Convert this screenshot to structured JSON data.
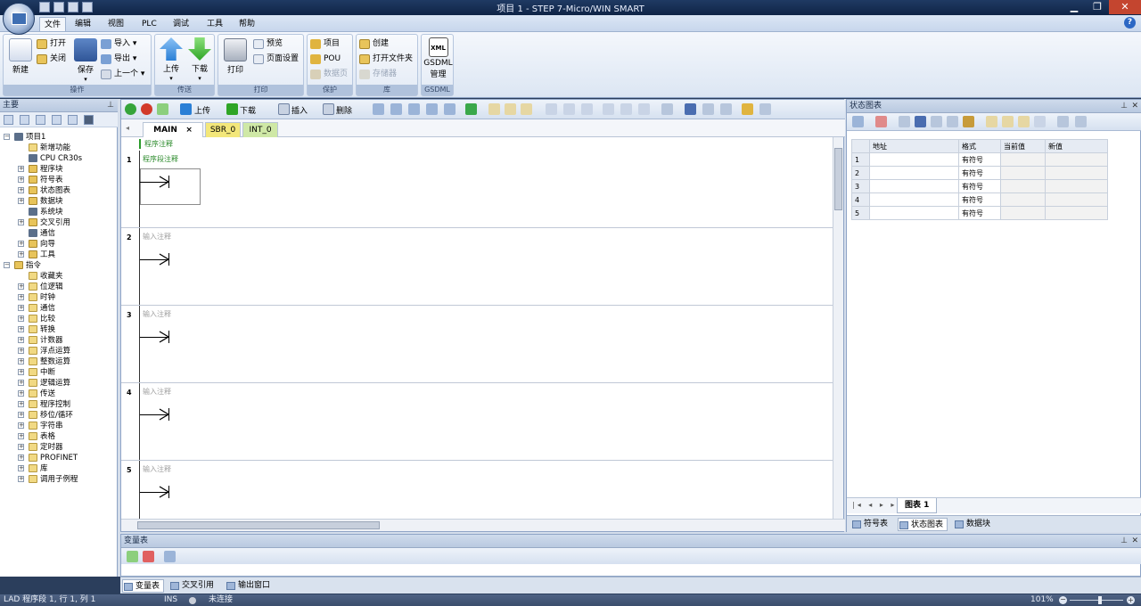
{
  "window": {
    "title": "项目 1 - STEP 7-Micro/WIN SMART"
  },
  "menu": [
    "文件",
    "编辑",
    "视图",
    "PLC",
    "调试",
    "工具",
    "帮助"
  ],
  "ribbon": {
    "groups": [
      {
        "label": "操作",
        "new": "新建",
        "open": "打开",
        "close": "关闭",
        "save": "保存",
        "import": "导入",
        "export": "导出",
        "previous": "上一个"
      },
      {
        "label": "传送",
        "upload": "上传",
        "download": "下载"
      },
      {
        "label": "打印",
        "print": "打印",
        "preview": "预览",
        "page_setup": "页面设置"
      },
      {
        "label": "保护",
        "project": "项目",
        "pou": "POU",
        "data_page": "数据页"
      },
      {
        "label": "库",
        "create": "创建",
        "open_folder": "打开文件夹",
        "memory": "存储器"
      },
      {
        "label": "GSDML",
        "gsdml_line1": "GSDML",
        "gsdml_line2": "管理",
        "xml": "XML"
      }
    ]
  },
  "tree": {
    "title": "主要",
    "items": [
      {
        "label": "项目1",
        "level": 0,
        "exp": "−",
        "icon": "project"
      },
      {
        "label": "新增功能",
        "level": 1,
        "exp": "",
        "icon": "new"
      },
      {
        "label": "CPU CR30s",
        "level": 1,
        "exp": "",
        "icon": "cpu"
      },
      {
        "label": "程序块",
        "level": 1,
        "exp": "+",
        "icon": "folder"
      },
      {
        "label": "符号表",
        "level": 1,
        "exp": "+",
        "icon": "folder"
      },
      {
        "label": "状态图表",
        "level": 1,
        "exp": "+",
        "icon": "folder"
      },
      {
        "label": "数据块",
        "level": 1,
        "exp": "+",
        "icon": "folder"
      },
      {
        "label": "系统块",
        "level": 1,
        "exp": "",
        "icon": "system"
      },
      {
        "label": "交叉引用",
        "level": 1,
        "exp": "+",
        "icon": "folder"
      },
      {
        "label": "通信",
        "level": 1,
        "exp": "",
        "icon": "comm"
      },
      {
        "label": "向导",
        "level": 1,
        "exp": "+",
        "icon": "folder"
      },
      {
        "label": "工具",
        "level": 1,
        "exp": "+",
        "icon": "folder"
      },
      {
        "label": "指令",
        "level": 0,
        "exp": "−",
        "icon": "folder"
      },
      {
        "label": "收藏夹",
        "level": 1,
        "exp": "",
        "icon": "folder2"
      },
      {
        "label": "位逻辑",
        "level": 1,
        "exp": "+",
        "icon": "folder2"
      },
      {
        "label": "时钟",
        "level": 1,
        "exp": "+",
        "icon": "folder2"
      },
      {
        "label": "通信",
        "level": 1,
        "exp": "+",
        "icon": "folder2"
      },
      {
        "label": "比较",
        "level": 1,
        "exp": "+",
        "icon": "folder2"
      },
      {
        "label": "转换",
        "level": 1,
        "exp": "+",
        "icon": "folder2"
      },
      {
        "label": "计数器",
        "level": 1,
        "exp": "+",
        "icon": "folder2"
      },
      {
        "label": "浮点运算",
        "level": 1,
        "exp": "+",
        "icon": "folder2"
      },
      {
        "label": "整数运算",
        "level": 1,
        "exp": "+",
        "icon": "folder2"
      },
      {
        "label": "中断",
        "level": 1,
        "exp": "+",
        "icon": "folder2"
      },
      {
        "label": "逻辑运算",
        "level": 1,
        "exp": "+",
        "icon": "folder2"
      },
      {
        "label": "传送",
        "level": 1,
        "exp": "+",
        "icon": "folder2"
      },
      {
        "label": "程序控制",
        "level": 1,
        "exp": "+",
        "icon": "folder2"
      },
      {
        "label": "移位/循环",
        "level": 1,
        "exp": "+",
        "icon": "folder2"
      },
      {
        "label": "字符串",
        "level": 1,
        "exp": "+",
        "icon": "folder2"
      },
      {
        "label": "表格",
        "level": 1,
        "exp": "+",
        "icon": "folder2"
      },
      {
        "label": "定时器",
        "level": 1,
        "exp": "+",
        "icon": "folder2"
      },
      {
        "label": "PROFINET",
        "level": 1,
        "exp": "+",
        "icon": "folder2"
      },
      {
        "label": "库",
        "level": 1,
        "exp": "+",
        "icon": "folder2"
      },
      {
        "label": "调用子例程",
        "level": 1,
        "exp": "+",
        "icon": "folder2"
      }
    ]
  },
  "editor": {
    "toolbar": {
      "upload": "上传",
      "download": "下载",
      "insert": "插入",
      "delete": "删除"
    },
    "tabs": [
      "MAIN",
      "SBR_0",
      "INT_0"
    ],
    "tab_close": "×",
    "program_comment": "程序注释",
    "networks": [
      {
        "num": "1",
        "comment": "程序段注释"
      },
      {
        "num": "2",
        "comment": "输入注释"
      },
      {
        "num": "3",
        "comment": "输入注释"
      },
      {
        "num": "4",
        "comment": "输入注释"
      },
      {
        "num": "5",
        "comment": "输入注释"
      }
    ]
  },
  "status_chart": {
    "title": "状态图表",
    "columns": [
      "地址",
      "格式",
      "当前值",
      "新值"
    ],
    "rows": [
      {
        "n": "1",
        "address": "",
        "format": "有符号",
        "current": "",
        "new": ""
      },
      {
        "n": "2",
        "address": "",
        "format": "有符号",
        "current": "",
        "new": ""
      },
      {
        "n": "3",
        "address": "",
        "format": "有符号",
        "current": "",
        "new": ""
      },
      {
        "n": "4",
        "address": "",
        "format": "有符号",
        "current": "",
        "new": ""
      },
      {
        "n": "5",
        "address": "",
        "format": "有符号",
        "current": "",
        "new": ""
      }
    ],
    "sheet_tab": "图表 1",
    "panel_tabs": [
      "符号表",
      "状态图表",
      "数据块"
    ]
  },
  "var_table": {
    "title": "变量表"
  },
  "bottom_tabs": [
    "变量表",
    "交叉引用",
    "输出窗口"
  ],
  "statusbar": {
    "position": "LAD 程序段 1, 行 1, 列 1",
    "mode": "INS",
    "connection": "未连接",
    "zoom": "101%"
  }
}
